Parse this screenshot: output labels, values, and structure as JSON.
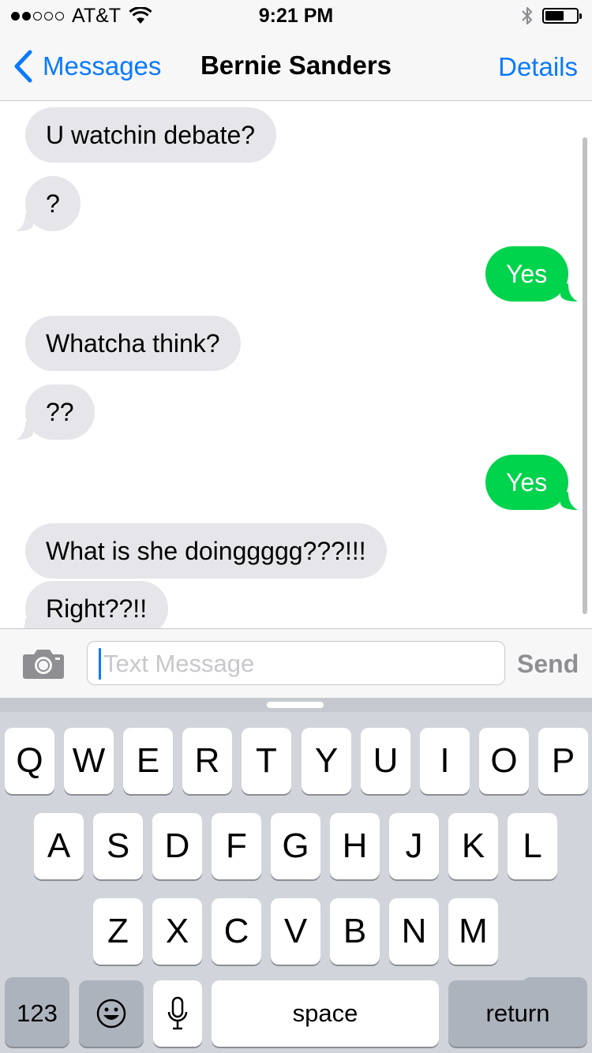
{
  "status": {
    "carrier": "AT&T",
    "time": "9:21 PM",
    "signal_bars": 2,
    "signal_total": 5,
    "battery_level": 0.6
  },
  "nav": {
    "back_label": "Messages",
    "title": "Bernie Sanders",
    "details_label": "Details"
  },
  "messages": [
    {
      "dir": "in",
      "text": "U watchin debate?"
    },
    {
      "dir": "in",
      "text": "?"
    },
    {
      "dir": "out",
      "text": "Yes"
    },
    {
      "dir": "in",
      "text": "Whatcha think?"
    },
    {
      "dir": "in",
      "text": "??"
    },
    {
      "dir": "out",
      "text": "Yes"
    },
    {
      "dir": "in",
      "text": "What is she doinggggg???!!!"
    },
    {
      "dir": "in",
      "text": "Right??!!"
    }
  ],
  "composer": {
    "placeholder": "Text Message",
    "send_label": "Send"
  },
  "keyboard": {
    "row1": [
      "Q",
      "W",
      "E",
      "R",
      "T",
      "Y",
      "U",
      "I",
      "O",
      "P"
    ],
    "row2": [
      "A",
      "S",
      "D",
      "F",
      "G",
      "H",
      "J",
      "K",
      "L"
    ],
    "row3": [
      "Z",
      "X",
      "C",
      "V",
      "B",
      "N",
      "M"
    ],
    "numbers_label": "123",
    "space_label": "space",
    "return_label": "return"
  },
  "colors": {
    "accent": "#0a7aff",
    "outgoing": "#00d34c",
    "incoming": "#e5e5ea"
  }
}
